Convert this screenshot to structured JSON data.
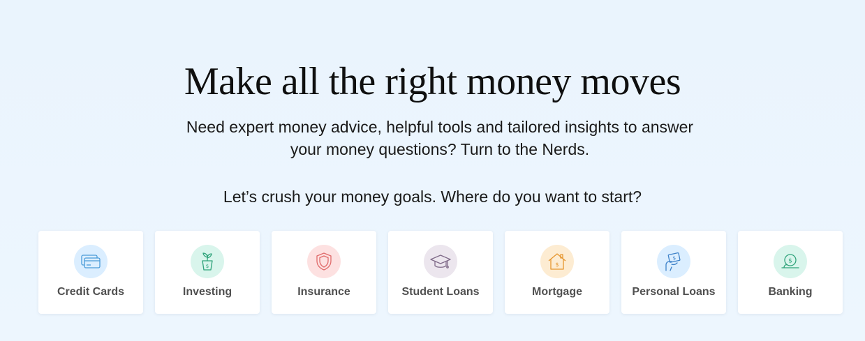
{
  "hero": {
    "headline": "Make all the right money moves",
    "subhead_line1": "Need expert money advice, helpful tools and tailored insights to answer",
    "subhead_line2": "your money questions? Turn to the Nerds.",
    "prompt": "Let’s crush your money goals. Where do you want to start?"
  },
  "categories": [
    {
      "label": "Credit Cards",
      "icon": "credit-card-icon",
      "bg": "#dbeeff",
      "stroke": "#4a9bd8"
    },
    {
      "label": "Investing",
      "icon": "plant-pot-icon",
      "bg": "#d9f5ec",
      "stroke": "#2fa37a"
    },
    {
      "label": "Insurance",
      "icon": "shield-icon",
      "bg": "#fde1e1",
      "stroke": "#e06a6a"
    },
    {
      "label": "Student Loans",
      "icon": "graduation-cap-icon",
      "bg": "#ece6ee",
      "stroke": "#7f6a88"
    },
    {
      "label": "Mortgage",
      "icon": "house-icon",
      "bg": "#fdecd2",
      "stroke": "#e6962e"
    },
    {
      "label": "Personal Loans",
      "icon": "hand-cash-icon",
      "bg": "#dbeeff",
      "stroke": "#3e82c9"
    },
    {
      "label": "Banking",
      "icon": "piggy-coin-icon",
      "bg": "#d9f5ec",
      "stroke": "#2fa37a"
    }
  ]
}
